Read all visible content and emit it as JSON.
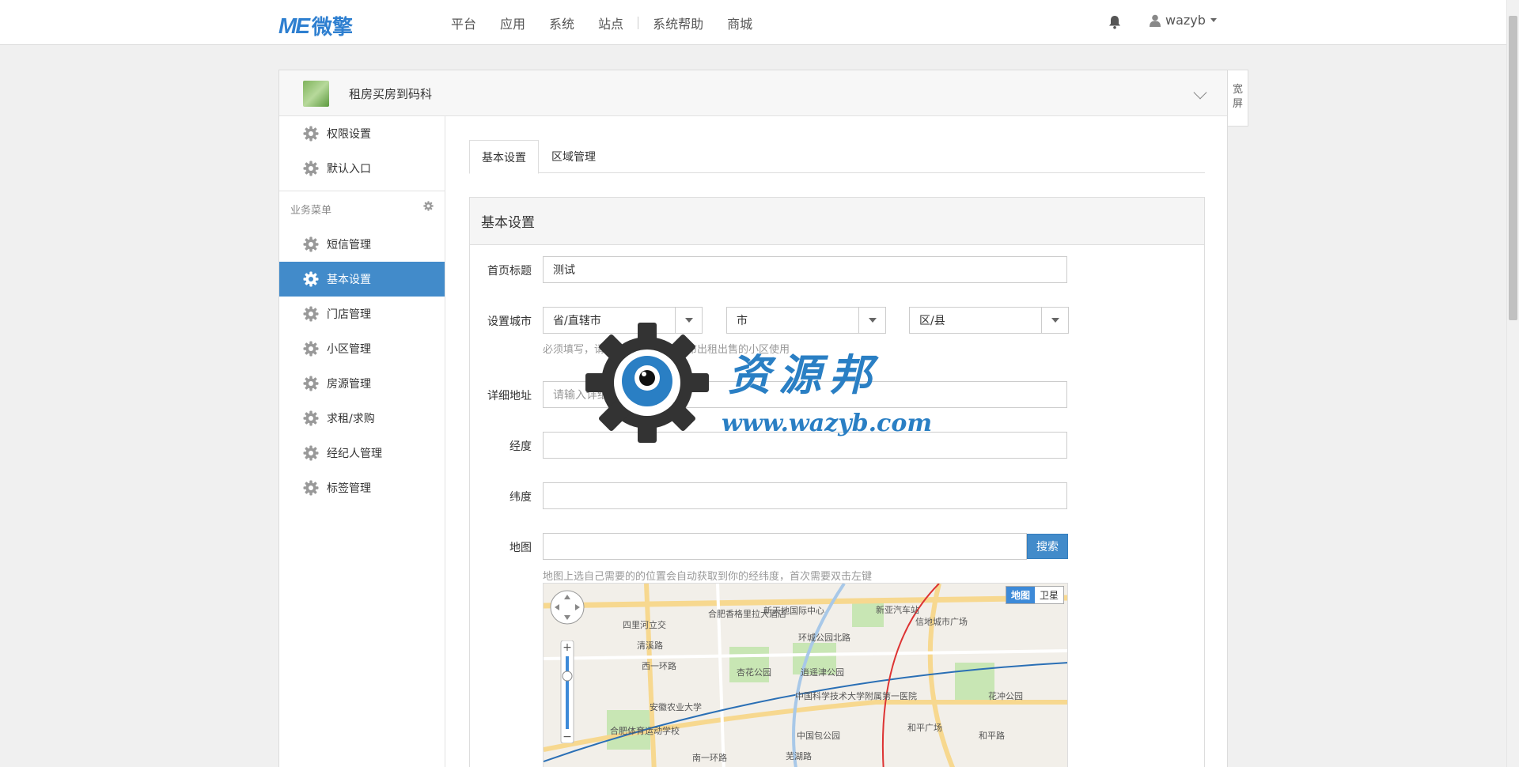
{
  "topbar": {
    "logo_me": "ME",
    "logo_cn": "微擎",
    "nav": [
      "平台",
      "应用",
      "系统",
      "站点",
      "系统帮助",
      "商城"
    ],
    "username": "wazyb"
  },
  "app": {
    "title": "租房买房到码科",
    "wide_label_1": "宽",
    "wide_label_2": "屏"
  },
  "sidebar": {
    "top_items": [
      "权限设置",
      "默认入口"
    ],
    "group_title": "业务菜单",
    "items": [
      "短信管理",
      "基本设置",
      "门店管理",
      "小区管理",
      "房源管理",
      "求租/求购",
      "经纪人管理",
      "标签管理"
    ],
    "active_index": 1
  },
  "tabs": [
    "基本设置",
    "区域管理"
  ],
  "form": {
    "panel_title": "基本设置",
    "home_title_label": "首页标题",
    "home_title_value": "测试",
    "city_label": "设置城市",
    "province_value": "省/直辖市",
    "city_value": "市",
    "district_value": "区/县",
    "city_help": "必须填写，请精确到市，用于发布出租出售的小区使用",
    "address_label": "详细地址",
    "address_placeholder": "请输入详细地址",
    "lng_label": "经度",
    "lat_label": "纬度",
    "map_label": "地图",
    "search_button": "搜索",
    "map_help": "地图上选自己需要的的位置会自动获取到你的经纬度，首次需要双击左键"
  },
  "map": {
    "type_map": "地图",
    "type_satellite": "卫星",
    "labels": [
      "四里河立交",
      "清溪路",
      "合肥香格里拉大酒店",
      "新天地国际中心",
      "杏花公园",
      "逍遥津公园",
      "新亚汽车站",
      "信地城市广场",
      "安徽农业大学",
      "中国科学技术大学附属第一医院",
      "合肥体育运动学校",
      "中国包公园",
      "和平广场",
      "和平路",
      "花冲公园",
      "南一环路",
      "芜湖路",
      "环城公园北路",
      "西一环路"
    ]
  },
  "watermark": {
    "brand": "资源邦",
    "url": "www.wazyb.com"
  },
  "colors": {
    "primary": "#428bca",
    "logo": "#2e7fd0"
  }
}
